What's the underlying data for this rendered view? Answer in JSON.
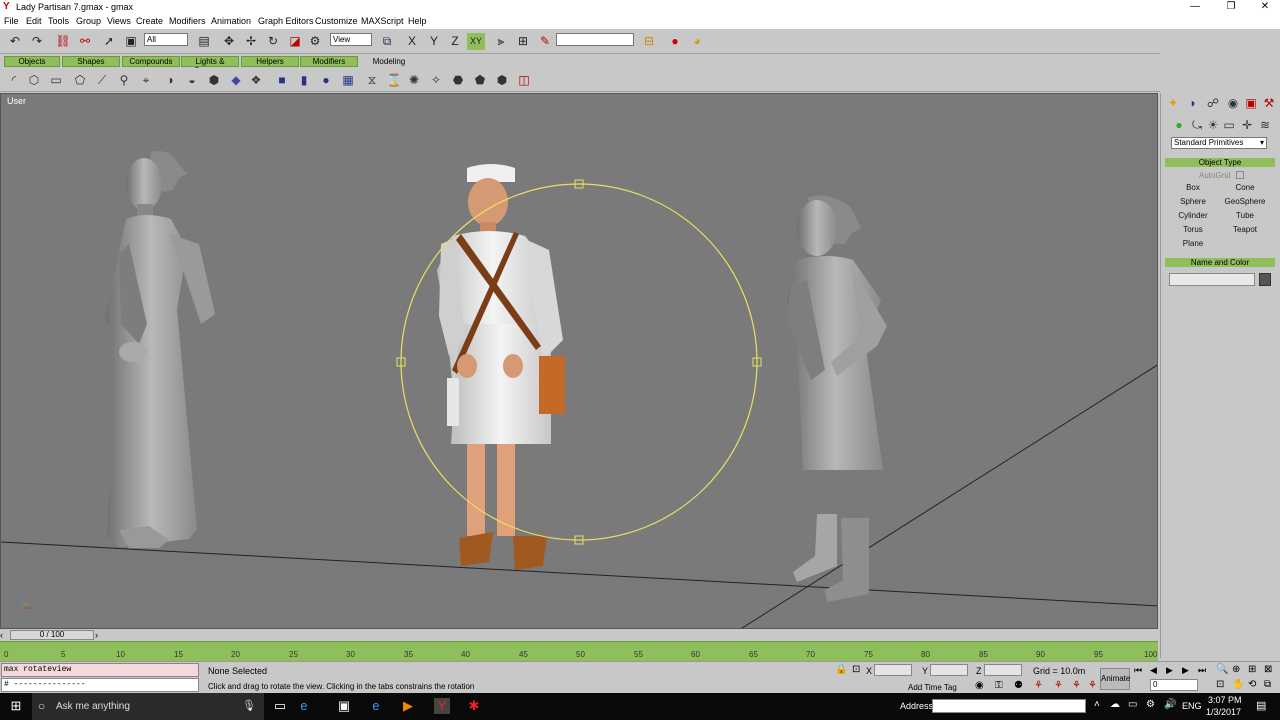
{
  "window": {
    "title": "Lady Partisan 7.gmax - gmax",
    "minimize": "—",
    "restore": "❐",
    "close": "✕"
  },
  "menu": [
    "File",
    "Edit",
    "Tools",
    "Group",
    "Views",
    "Create",
    "Modifiers",
    "Animation",
    "Graph Editors",
    "Customize",
    "MAXScript",
    "Help"
  ],
  "toolbar": {
    "selection_filter": "All",
    "reference_coord": "View",
    "axis_x": "X",
    "axis_y": "Y",
    "axis_z": "Z",
    "axis_xy": "XY"
  },
  "tabs": [
    "Objects",
    "Shapes",
    "Compounds",
    "Lights & Cameras",
    "Helpers",
    "Modifiers",
    "Modeling"
  ],
  "viewport": {
    "label": "User"
  },
  "command_panel": {
    "dropdown": "Standard Primitives",
    "object_type_title": "Object Type",
    "autogrid": "AutoGrid",
    "buttons": [
      "Box",
      "Cone",
      "Sphere",
      "GeoSphere",
      "Cylinder",
      "Tube",
      "Torus",
      "Teapot",
      "Plane"
    ],
    "name_color_title": "Name and Color"
  },
  "timeline": {
    "frame_display": "0 / 100",
    "ticks": [
      "0",
      "5",
      "10",
      "15",
      "20",
      "25",
      "30",
      "35",
      "40",
      "45",
      "50",
      "55",
      "60",
      "65",
      "70",
      "75",
      "80",
      "85",
      "90",
      "95",
      "100"
    ]
  },
  "status": {
    "script_line": "max rotateview",
    "script_line2": "# ---------------",
    "selection": "None Selected",
    "prompt": "Click and drag to rotate the view.  Clicking in the tabs constrains the rotation",
    "x_label": "X",
    "y_label": "Y",
    "z_label": "Z",
    "grid": "Grid = 10.0m",
    "add_time_tag": "Add Time Tag",
    "animate": "Animate",
    "frame_field": "0"
  },
  "taskbar": {
    "search_placeholder": "Ask me anything",
    "address_label": "Address",
    "language": "ENG",
    "time": "3:07 PM",
    "date": "1/3/2017"
  }
}
